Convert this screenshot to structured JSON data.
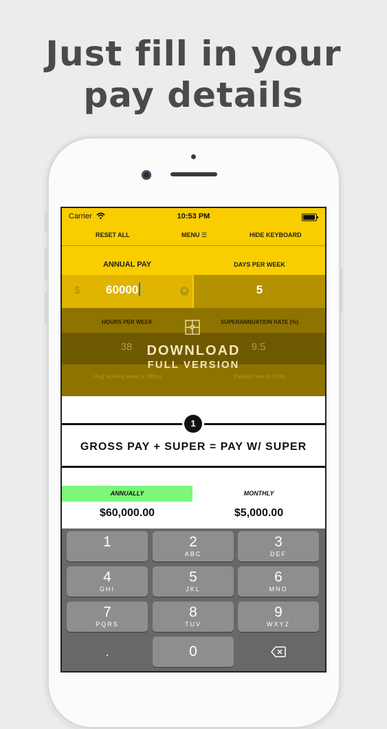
{
  "headline": {
    "line1": "Just fill in your",
    "line2": "pay details"
  },
  "status_bar": {
    "carrier": "Carrier",
    "time": "10:53 PM"
  },
  "toolbar": {
    "reset": "RESET ALL",
    "menu": "MENU ☰",
    "hide_keyboard": "HIDE KEYBOARD"
  },
  "form": {
    "annual_pay_label": "ANNUAL PAY",
    "days_per_week_label": "DAYS PER WEEK",
    "currency": "$",
    "annual_pay_value": "60000",
    "days_per_week_value": "5",
    "hours_per_week_label": "HOURS PER WEEK",
    "super_rate_label": "SUPERANNUATION RATE (%)",
    "hours_per_week_value": "38",
    "super_rate_value": "9.5",
    "hours_hint": "(Avg working week is 38hrs)",
    "super_hint": "(Default rate of 9.5%)"
  },
  "overlay": {
    "line1": "DOWNLOAD",
    "line2": "FULL VERSION"
  },
  "result": {
    "step": "1",
    "formula": "GROSS PAY + SUPER = PAY W/ SUPER",
    "tab_annually": "ANNUALLY",
    "tab_monthly": "MONTHLY",
    "annual_amount": "$60,000.00",
    "monthly_amount": "$5,000.00"
  },
  "keypad": {
    "k1": {
      "num": "1",
      "sub": ""
    },
    "k2": {
      "num": "2",
      "sub": "ABC"
    },
    "k3": {
      "num": "3",
      "sub": "DEF"
    },
    "k4": {
      "num": "4",
      "sub": "GHI"
    },
    "k5": {
      "num": "5",
      "sub": "JKL"
    },
    "k6": {
      "num": "6",
      "sub": "MNO"
    },
    "k7": {
      "num": "7",
      "sub": "PQRS"
    },
    "k8": {
      "num": "8",
      "sub": "TUV"
    },
    "k9": {
      "num": "9",
      "sub": "WXYZ"
    },
    "dot": ".",
    "k0": "0"
  },
  "colors": {
    "brand_yellow": "#f9cd00",
    "active_tab_green": "#7cf77a",
    "keyboard_bg": "#686868"
  },
  "icons": {
    "wifi": "wifi-icon",
    "battery": "battery-icon",
    "clear": "clear-icon",
    "puzzle": "puzzle-icon",
    "backspace": "backspace-icon"
  }
}
